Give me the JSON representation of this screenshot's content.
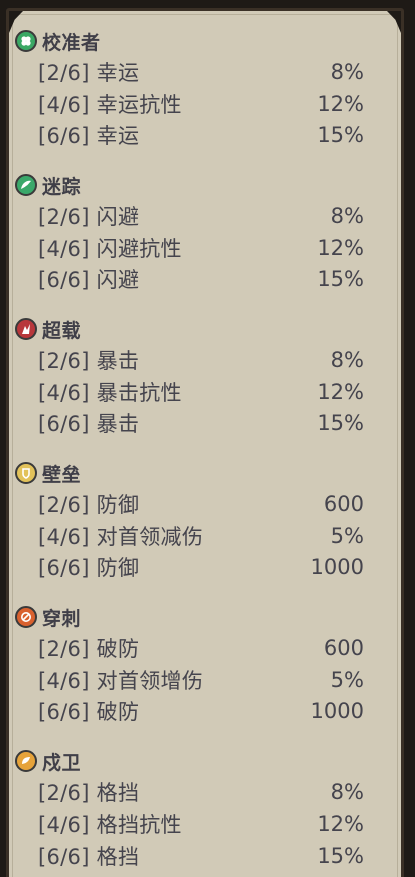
{
  "groups": [
    {
      "title": "校准者",
      "icon": "clover-icon",
      "color": "#3aa864",
      "bonuses": [
        {
          "label": "[2/6] 幸运",
          "value": "8%"
        },
        {
          "label": "[4/6] 幸运抗性",
          "value": "12%"
        },
        {
          "label": "[6/6] 幸运",
          "value": "15%"
        }
      ]
    },
    {
      "title": "迷踪",
      "icon": "wing-icon",
      "color": "#3aa86a",
      "bonuses": [
        {
          "label": "[2/6] 闪避",
          "value": "8%"
        },
        {
          "label": "[4/6] 闪避抗性",
          "value": "12%"
        },
        {
          "label": "[6/6] 闪避",
          "value": "15%"
        }
      ]
    },
    {
      "title": "超载",
      "icon": "crit-slash-icon",
      "color": "#b8373b",
      "bonuses": [
        {
          "label": "[2/6] 暴击",
          "value": "8%"
        },
        {
          "label": "[4/6] 暴击抗性",
          "value": "12%"
        },
        {
          "label": "[6/6] 暴击",
          "value": "15%"
        }
      ]
    },
    {
      "title": "壁垒",
      "icon": "shield-icon",
      "color": "#e2c25a",
      "bonuses": [
        {
          "label": "[2/6] 防御",
          "value": "600"
        },
        {
          "label": "[4/6] 对首领减伤",
          "value": "5%"
        },
        {
          "label": "[6/6] 防御",
          "value": "1000"
        }
      ]
    },
    {
      "title": "穿刺",
      "icon": "pierce-icon",
      "color": "#d9612e",
      "bonuses": [
        {
          "label": "[2/6] 破防",
          "value": "600"
        },
        {
          "label": "[4/6] 对首领增伤",
          "value": "5%"
        },
        {
          "label": "[6/6] 破防",
          "value": "1000"
        }
      ]
    },
    {
      "title": "戍卫",
      "icon": "guard-icon",
      "color": "#e6a33a",
      "bonuses": [
        {
          "label": "[2/6] 格挡",
          "value": "8%"
        },
        {
          "label": "[4/6] 格挡抗性",
          "value": "12%"
        },
        {
          "label": "[6/6] 格挡",
          "value": "15%"
        }
      ]
    }
  ]
}
